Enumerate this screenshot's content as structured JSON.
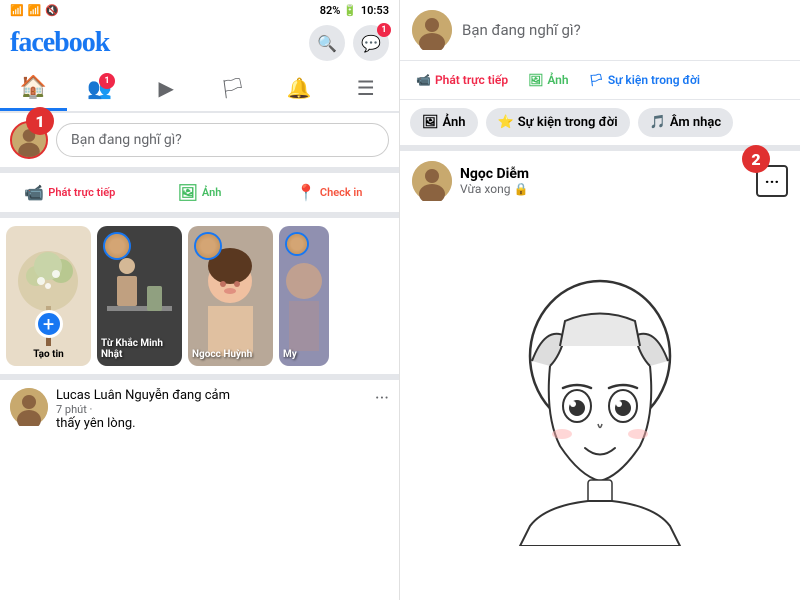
{
  "left": {
    "statusBar": {
      "signal": "📶 📶 🔇",
      "battery": "82% 🔋",
      "time": "10:53"
    },
    "logo": "facebook",
    "headerIcons": {
      "search": "🔍",
      "messenger": "💬",
      "messengerBadge": "1"
    },
    "navTabs": [
      {
        "id": "home",
        "label": "🏠",
        "active": true
      },
      {
        "id": "friends",
        "label": "👥",
        "badge": "1"
      },
      {
        "id": "video",
        "label": "▶"
      },
      {
        "id": "flag",
        "label": "🏳"
      },
      {
        "id": "bell",
        "label": "🔔"
      },
      {
        "id": "menu",
        "label": "☰"
      }
    ],
    "postInput": {
      "placeholder": "Bạn đang nghĩ gì?"
    },
    "actionButtons": [
      {
        "icon": "📹",
        "label": "Phát trực tiếp",
        "color": "live"
      },
      {
        "icon": "🖼",
        "label": "Ảnh",
        "color": "photo"
      },
      {
        "icon": "📍",
        "label": "Check in",
        "color": "checkin"
      }
    ],
    "stories": [
      {
        "id": "create",
        "label": "Tạo tin",
        "type": "create"
      },
      {
        "id": "story1",
        "label": "Từ Khắc Minh Nhật",
        "type": "user"
      },
      {
        "id": "story2",
        "label": "Ngocc Huỳnh",
        "type": "girl"
      },
      {
        "id": "story3",
        "label": "My",
        "type": "purple"
      }
    ],
    "post": {
      "name": "Lucas Luân Nguyễn",
      "action": "đang cảm",
      "desc": "thấy yên lòng.",
      "time": "7 phút ·"
    }
  },
  "right": {
    "inputPlaceholder": "Bạn đang nghĩ gì?",
    "actionButtons": [
      {
        "icon": "📹",
        "label": "Phát trực tiếp",
        "color": "live"
      },
      {
        "icon": "🖼",
        "label": "Ảnh",
        "color": "photo"
      },
      {
        "icon": "🏳",
        "label": "Sự kiện trong đời",
        "color": "event"
      }
    ],
    "mediaButtons": [
      {
        "icon": "🖼",
        "label": "Ảnh"
      },
      {
        "icon": "⭐",
        "label": "Sự kiện trong đời"
      },
      {
        "icon": "🎵",
        "label": "Âm nhạc"
      }
    ],
    "post": {
      "name": "Ngọc Diễm",
      "time": "Vừa xong",
      "privacy": "🔒"
    },
    "numberAnnotation": "2"
  },
  "annotations": {
    "number1": "1",
    "number2": "2"
  }
}
